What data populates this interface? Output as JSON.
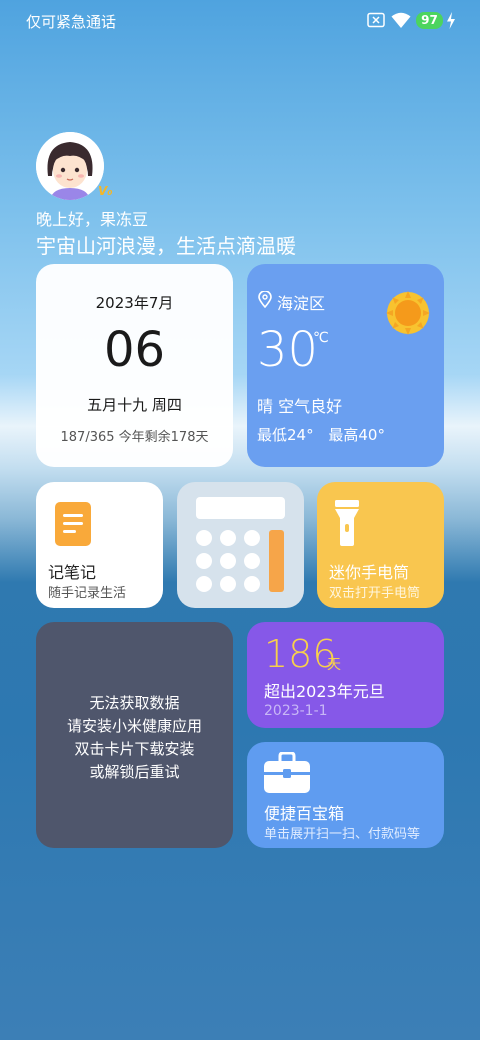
{
  "status_bar": {
    "carrier_text": "仅可紧急通话",
    "battery_level": "97",
    "icons": [
      "no-sim-icon",
      "wifi-icon",
      "battery-icon",
      "charging-bolt-icon"
    ]
  },
  "profile": {
    "vip_badge": "V₀",
    "greeting": "晚上好，果冻豆",
    "slogan": "宇宙山河浪漫，生活点滴温暖"
  },
  "calendar": {
    "year_month": "2023年7月",
    "day": "06",
    "lunar_weekday": "五月十九 周四",
    "progress": "187/365 今年剩余178天"
  },
  "weather": {
    "location": "海淀区",
    "temperature": "30",
    "unit": "℃",
    "condition": "晴 空气良好",
    "low": "最低24°",
    "high": "最高40°",
    "icon": "sun-icon"
  },
  "notes": {
    "title": "记笔记",
    "subtitle": "随手记录生活",
    "icon": "notepad-icon"
  },
  "calculator": {
    "icon": "calculator-icon"
  },
  "flashlight": {
    "title": "迷你手电筒",
    "subtitle": "双击打开手电筒",
    "icon": "flashlight-icon"
  },
  "health": {
    "lines": [
      "无法获取数据",
      "请安装小米健康应用",
      "双击卡片下载安装",
      "或解锁后重试"
    ]
  },
  "days_counter": {
    "count": "186",
    "unit": "天",
    "label": "超出2023年元旦",
    "date": "2023-1-1"
  },
  "toolbox": {
    "title": "便捷百宝箱",
    "subtitle": "单击展开扫一扫、付款码等",
    "icon": "toolbox-icon"
  },
  "colors": {
    "weather_card": "#6a9ff0",
    "flashlight_card": "#f9c64f",
    "health_card": "#4f566c",
    "days_card": "#8658e8",
    "toolbox_card": "#5f9cf0",
    "battery": "#4cd45f"
  }
}
